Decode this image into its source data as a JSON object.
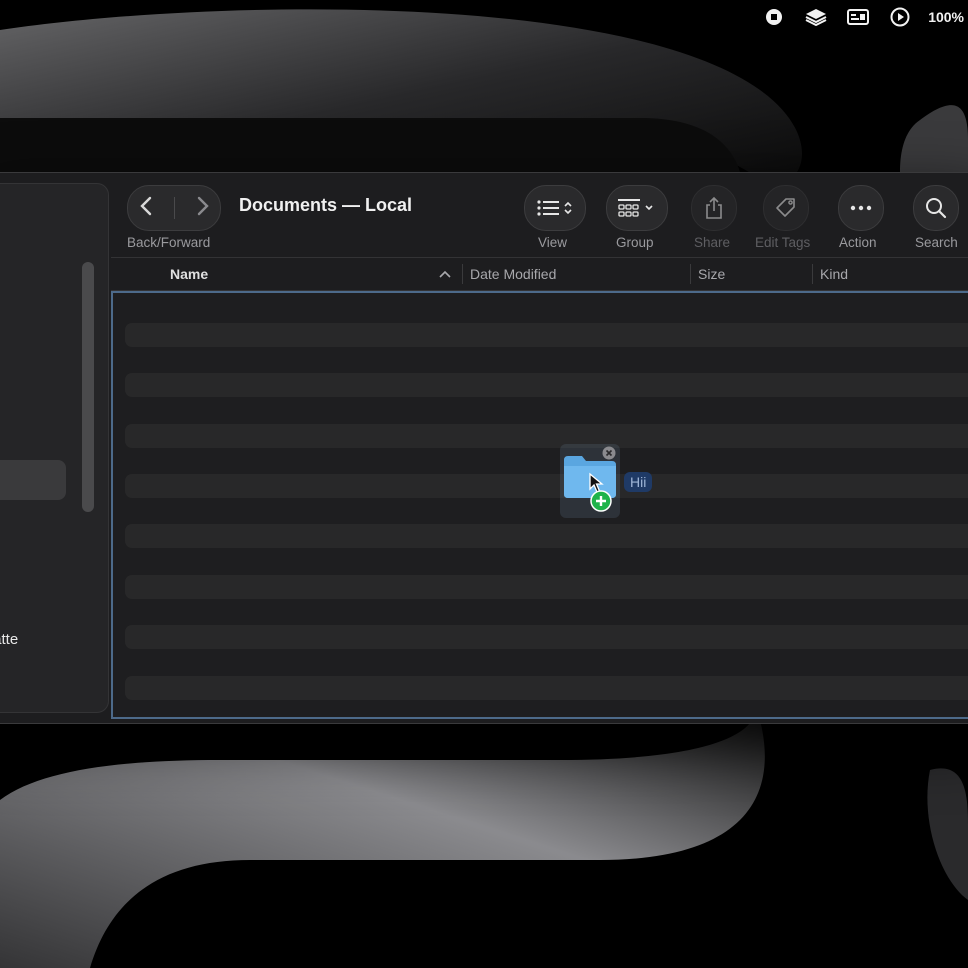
{
  "menubar": {
    "icons": [
      "stop-recording-icon",
      "layers-icon",
      "caption-icon",
      "play-icon"
    ],
    "battery": "100%"
  },
  "sidebar": {
    "visible_label": "uwatte"
  },
  "toolbar": {
    "title": "Documents — Local",
    "back_forward_label": "Back/Forward",
    "view_label": "View",
    "group_label": "Group",
    "share_label": "Share",
    "edit_tags_label": "Edit Tags",
    "action_label": "Action",
    "search_label": "Search"
  },
  "columns": {
    "name": "Name",
    "date_modified": "Date Modified",
    "size": "Size",
    "kind": "Kind"
  },
  "drag": {
    "item_label": "Hii"
  }
}
